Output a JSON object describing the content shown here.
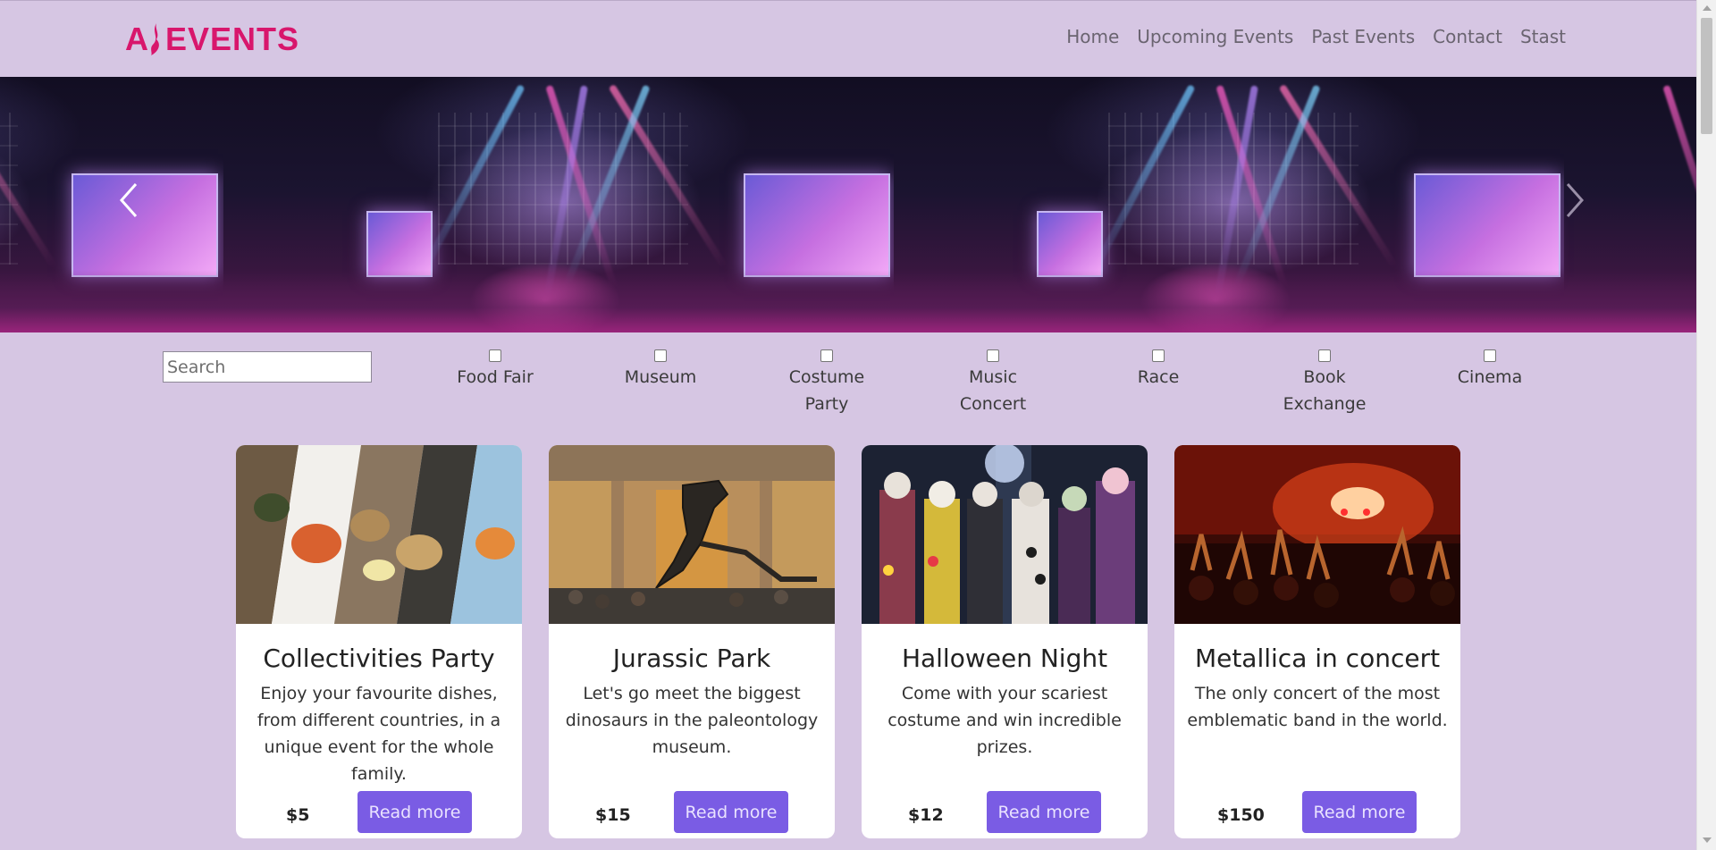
{
  "header": {
    "logo_text": "EVENTS",
    "logo_letter": "A",
    "brand_color": "#d8166c",
    "nav": [
      {
        "label": "Home"
      },
      {
        "label": "Upcoming Events"
      },
      {
        "label": "Past Events"
      },
      {
        "label": "Contact"
      },
      {
        "label": "Stast"
      }
    ]
  },
  "carousel": {
    "prev_icon": "chevron-left-icon",
    "next_icon": "chevron-right-icon"
  },
  "filters": {
    "search_placeholder": "Search",
    "categories": [
      {
        "label": "Food Fair",
        "checked": false
      },
      {
        "label": "Museum",
        "checked": false
      },
      {
        "label": "Costume Party",
        "checked": false
      },
      {
        "label": "Music Concert",
        "checked": false
      },
      {
        "label": "Race",
        "checked": false
      },
      {
        "label": "Book Exchange",
        "checked": false
      },
      {
        "label": "Cinema",
        "checked": false
      }
    ]
  },
  "events": [
    {
      "title": "Collectivities Party",
      "description": "Enjoy your favourite dishes, from different countries, in a unique event for the whole family.",
      "price": "$5",
      "button": "Read more"
    },
    {
      "title": "Jurassic Park",
      "description": "Let's go meet the biggest dinosaurs in the paleontology museum.",
      "price": "$15",
      "button": "Read more"
    },
    {
      "title": "Halloween Night",
      "description": "Come with your scariest costume and win incredible prizes.",
      "price": "$12",
      "button": "Read more"
    },
    {
      "title": "Metallica in concert",
      "description": "The only concert of the most emblematic band in the world.",
      "price": "$150",
      "button": "Read more"
    }
  ],
  "colors": {
    "page_bg": "#d6c6e3",
    "button_bg": "#7a5ce4",
    "button_text": "#e9e2ff"
  }
}
